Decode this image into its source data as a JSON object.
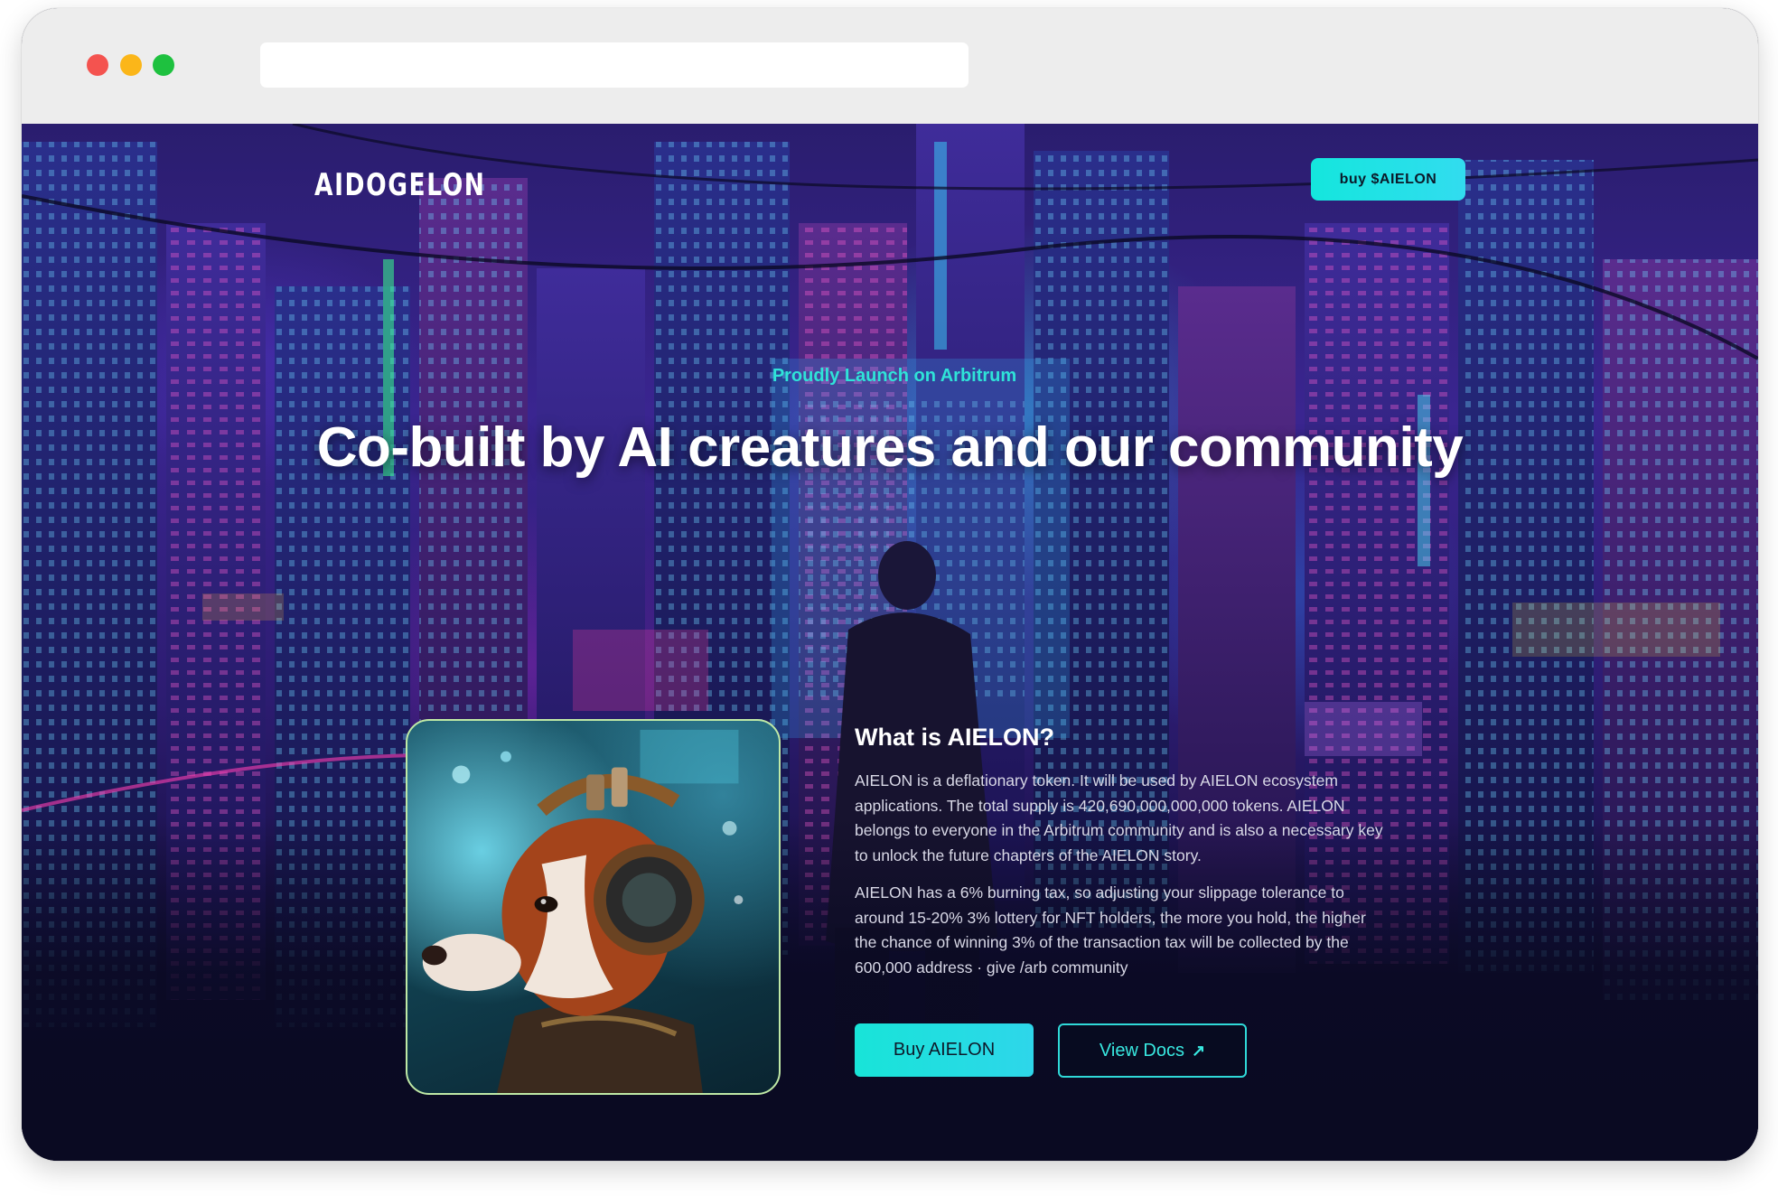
{
  "browser": {
    "address": ""
  },
  "nav": {
    "logo": "AIDOGELON",
    "buy_label": "buy $AIELON"
  },
  "hero": {
    "tagline": "Proudly Launch on Arbitrum",
    "headline": "Co-built by AI creatures and our community"
  },
  "about": {
    "title": "What is AIELON?",
    "paragraph_1": "AIELON is a deflationary token. It will be used by AIELON ecosystem applications. The total supply is 420,690,000,000,000 tokens. AIELON belongs to everyone in the Arbitrum community and is also a necessary key to unlock the future chapters of the AIELON story.",
    "paragraph_2": "AIELON has a 6% burning tax, so adjusting your slippage tolerance to around 15-20% 3% lottery for NFT holders, the more you hold, the higher the chance of winning 3% of the transaction tax will be collected by the 600,000 address  · give /arb community",
    "buy_button": "Buy AIELON",
    "docs_button": "View Docs",
    "docs_icon": "↗"
  },
  "colors": {
    "accent": "#1ee2da",
    "heading": "#ffffff",
    "tagline": "#2fe3d8",
    "background_dark": "#0a0a22"
  },
  "icons": {
    "window_controls": [
      "close-dot",
      "minimize-dot",
      "zoom-dot"
    ],
    "docs": "arrow-up-right-icon"
  }
}
